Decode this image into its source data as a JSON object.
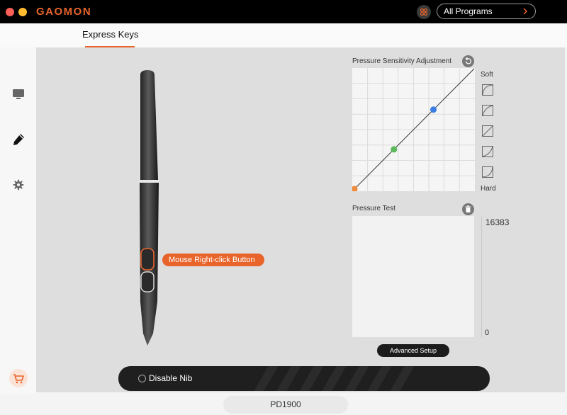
{
  "app": {
    "brand": "GAOMON",
    "program_select": "All Programs",
    "device": "PD1900"
  },
  "tabs": [
    {
      "label": "Express Keys",
      "active": true
    }
  ],
  "sidebar": {
    "items": [
      {
        "icon": "monitor-icon"
      },
      {
        "icon": "pen-icon",
        "active": true
      },
      {
        "icon": "gear-icon"
      }
    ],
    "footer_icon": "cart-icon"
  },
  "pen": {
    "callout": "Mouse Right-click Button"
  },
  "pressure_sensitivity": {
    "title": "Pressure Sensitivity Adjustment",
    "soft_label": "Soft",
    "hard_label": "Hard",
    "points": [
      {
        "x": 0.0,
        "y": 0.0,
        "color": "#f08a3c"
      },
      {
        "x": 0.33,
        "y": 0.33,
        "color": "#5cb85c"
      },
      {
        "x": 0.66,
        "y": 0.66,
        "color": "#3b7de0"
      }
    ]
  },
  "pressure_test": {
    "title": "Pressure Test",
    "max_value": "16383",
    "min_value": "0"
  },
  "buttons": {
    "advanced_setup": "Advanced Setup",
    "disable_nib": "Disable Nib"
  },
  "colors": {
    "accent": "#e8642a"
  }
}
